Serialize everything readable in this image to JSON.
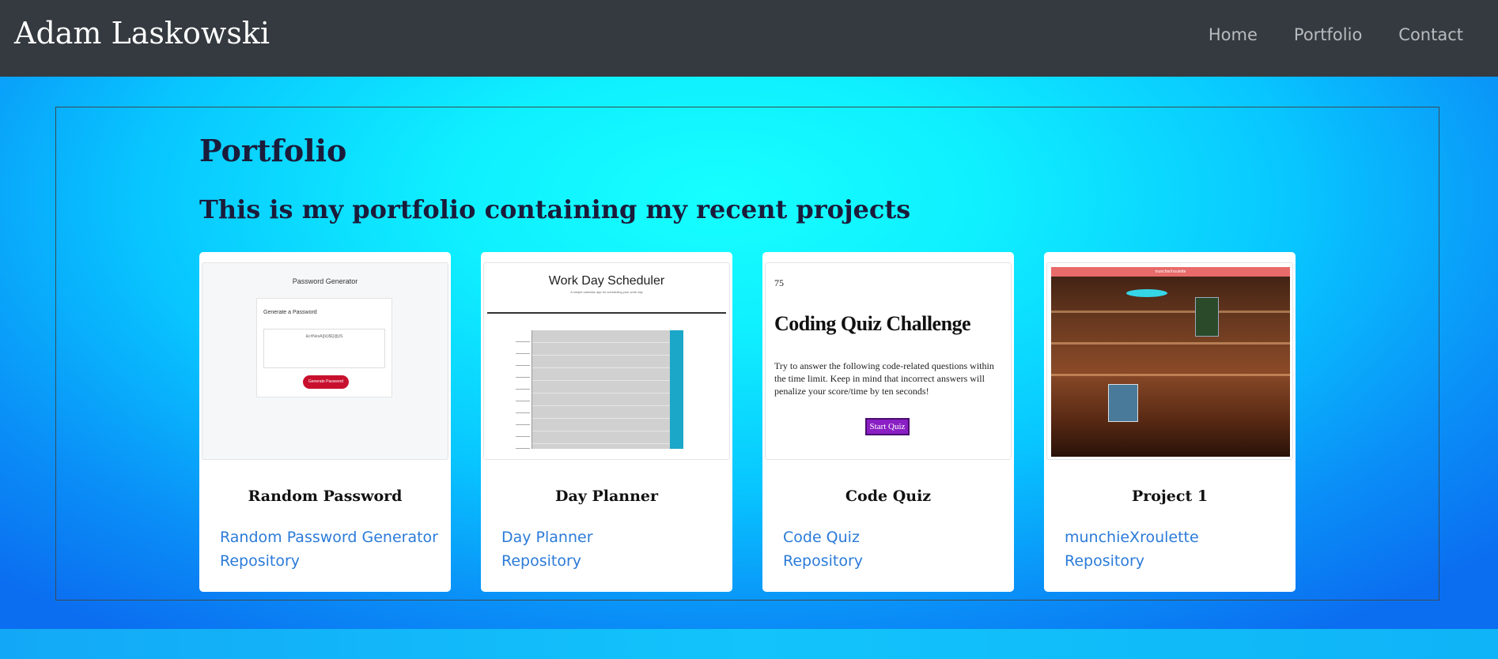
{
  "header": {
    "brand": "Adam Laskowski",
    "nav": [
      "Home",
      "Portfolio",
      "Contact"
    ]
  },
  "main": {
    "title": "Portfolio",
    "subtitle": "This is my portfolio containing my recent projects"
  },
  "cards": [
    {
      "title": "Random Password",
      "link": "Random Password Generator",
      "repo": "Repository",
      "thumb": {
        "title": "Password Generator",
        "label": "Generate a Password",
        "value": "&c#NesA{|k}i$Q@j/S",
        "button": "Generate Password"
      }
    },
    {
      "title": "Day Planner",
      "link": "Day Planner",
      "repo": "Repository",
      "thumb": {
        "title": "Work Day Scheduler",
        "subtitle": "A simple calendar app for scheduling your work day"
      }
    },
    {
      "title": "Code Quiz",
      "link": "Code Quiz",
      "repo": "Repository",
      "thumb": {
        "score": "75",
        "heading": "Coding Quiz Challenge",
        "text": "Try to answer the following code-related questions within the time limit. Keep in mind that incorrect answers will penalize your score/time by ten seconds!",
        "button": "Start Quiz"
      }
    },
    {
      "title": "Project 1",
      "link": "munchieXroulette",
      "repo": "Repository",
      "thumb": {
        "banner": "munchieXroulette"
      }
    }
  ]
}
